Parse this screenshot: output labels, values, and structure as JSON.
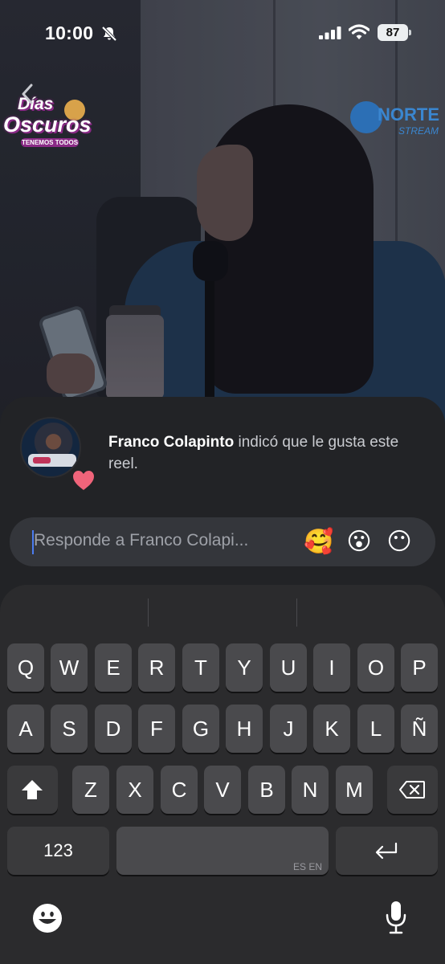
{
  "status_bar": {
    "time": "10:00",
    "battery": "87"
  },
  "video": {
    "logo_left": {
      "line1": "Días",
      "line2": "Oscuros",
      "tagline": "TENEMOS TODOS"
    },
    "logo_right": {
      "line1": "NORTE",
      "line2": "STREAM"
    }
  },
  "notification": {
    "name": "Franco Colapinto",
    "message": " indicó que le gusta este reel."
  },
  "reply": {
    "placeholder": "Responde a Franco Colapi...",
    "emojis": [
      "🥰",
      "😮",
      "😶"
    ]
  },
  "keyboard": {
    "row1": [
      "Q",
      "W",
      "E",
      "R",
      "T",
      "Y",
      "U",
      "I",
      "O",
      "P"
    ],
    "row2": [
      "A",
      "S",
      "D",
      "F",
      "G",
      "H",
      "J",
      "K",
      "L",
      "Ñ"
    ],
    "row3": [
      "Z",
      "X",
      "C",
      "V",
      "B",
      "N",
      "M"
    ],
    "numbers_key": "123",
    "space_lang": "ES EN"
  }
}
